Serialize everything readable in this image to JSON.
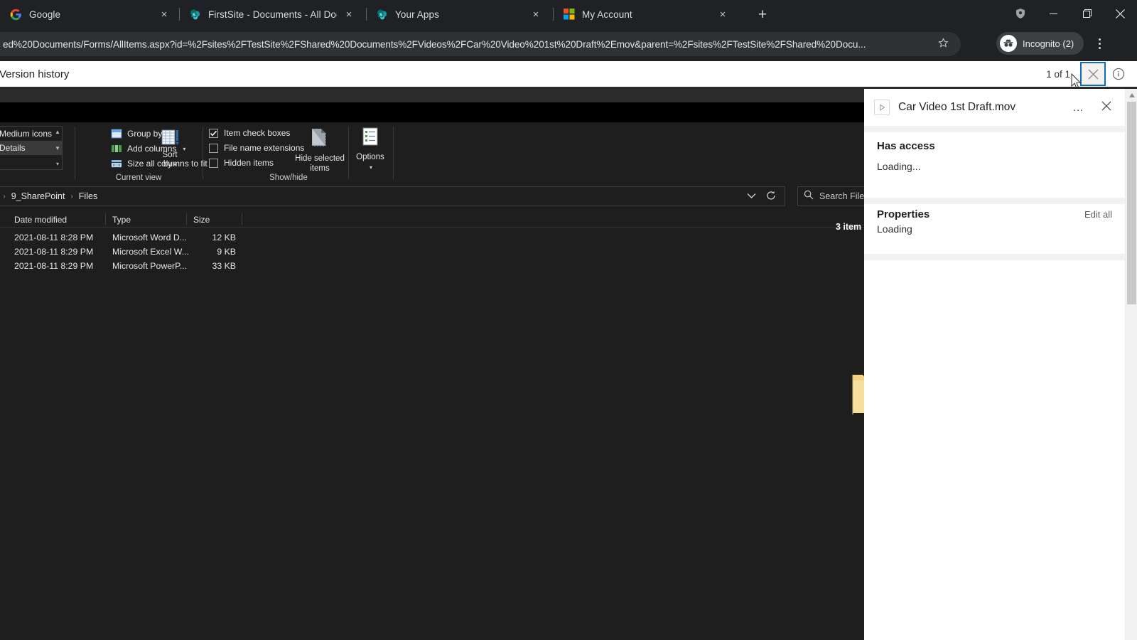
{
  "browser": {
    "tabs": [
      {
        "title": "Google",
        "icon": "google-icon",
        "close_label": "×"
      },
      {
        "title": "FirstSite - Documents - All Docum",
        "icon": "sharepoint-icon",
        "close_label": "×"
      },
      {
        "title": "Your Apps",
        "icon": "sharepoint-icon",
        "close_label": "×"
      },
      {
        "title": "My Account",
        "icon": "microsoft-icon",
        "close_label": "×"
      }
    ],
    "new_tab_label": "+",
    "window_controls": {
      "minimize": "─",
      "maximize": "❐",
      "close": "✕"
    },
    "omnibox": {
      "url": "ed%20Documents/Forms/AllItems.aspx?id=%2Fsites%2FTestSite%2FShared%20Documents%2FVideos%2FCar%20Video%201st%20Draft%2Emov&parent=%2Fsites%2FTestSite%2FShared%20Docu...",
      "star_icon": "star-icon"
    },
    "profile": {
      "label": "Incognito (2)",
      "icon": "incognito-icon"
    },
    "menu_icon": "kebab-menu-icon",
    "extensions_icon": "shield-icon"
  },
  "version_history": {
    "title": "Version history",
    "count": "1 of 1",
    "close_label": "✕",
    "info_label": "i"
  },
  "explorer": {
    "ribbon": {
      "layout_gallery": {
        "items": [
          {
            "label": "Medium icons",
            "selected": false
          },
          {
            "label": "Details",
            "selected": true
          }
        ],
        "scroll_up": "▲",
        "scroll_down": "▼",
        "scroll_more": "▾"
      },
      "sort_by": {
        "label_line1": "Sort",
        "label_line2": "by",
        "caret": "▾",
        "icon": "sort-columns-icon"
      },
      "commands": [
        {
          "label": "Group by",
          "caret": "▾",
          "icon": "group-by-icon"
        },
        {
          "label": "Add columns",
          "caret": "▾",
          "icon": "add-columns-icon"
        },
        {
          "label": "Size all columns to fit",
          "caret": "",
          "icon": "size-columns-icon"
        }
      ],
      "checkboxes": [
        {
          "label": "Item check boxes",
          "checked": true
        },
        {
          "label": "File name extensions",
          "checked": false
        },
        {
          "label": "Hidden items",
          "checked": false
        }
      ],
      "hide_selected": {
        "line1": "Hide selected",
        "line2": "items",
        "icon": "hide-items-icon"
      },
      "options": {
        "label": "Options",
        "caret": "▾",
        "icon": "options-icon"
      },
      "group_labels": {
        "current_view": "Current view",
        "show_hide": "Show/hide"
      }
    },
    "address": {
      "breadcrumbs": [
        "9_SharePoint",
        "Files"
      ],
      "separator": "›",
      "leading_separator": "›",
      "dropdown_icon": "chevron-down-icon",
      "refresh_icon": "refresh-icon"
    },
    "search": {
      "placeholder": "Search Files",
      "icon": "search-icon"
    },
    "columns": [
      {
        "label": "Date modified"
      },
      {
        "label": "Type"
      },
      {
        "label": "Size"
      }
    ],
    "rows": [
      {
        "date": "2021-08-11 8:28 PM",
        "type": "Microsoft Word D...",
        "size": "12 KB"
      },
      {
        "date": "2021-08-11 8:29 PM",
        "type": "Microsoft Excel W...",
        "size": "9 KB"
      },
      {
        "date": "2021-08-11 8:29 PM",
        "type": "Microsoft PowerP...",
        "size": "33 KB"
      }
    ],
    "status": {
      "items_count": "3 item"
    }
  },
  "details_pane": {
    "file_name": "Car Video 1st Draft.mov",
    "file_icon": "video-file-icon",
    "more_label": "…",
    "close_label": "✕",
    "access": {
      "title": "Has access",
      "status": "Loading..."
    },
    "properties": {
      "title": "Properties",
      "status": "Loading",
      "edit_all": "Edit all"
    },
    "scrollbar": {
      "up_arrow": "▲"
    }
  },
  "colors": {
    "browser_chrome": "#202124",
    "omnibox": "#303134",
    "explorer_bg": "#1e1e1e",
    "pane_bg": "#ffffff",
    "focus_blue": "#0f6cbd",
    "sharepoint_teal": "#038387",
    "folder_yellow": "#f5d98a"
  }
}
